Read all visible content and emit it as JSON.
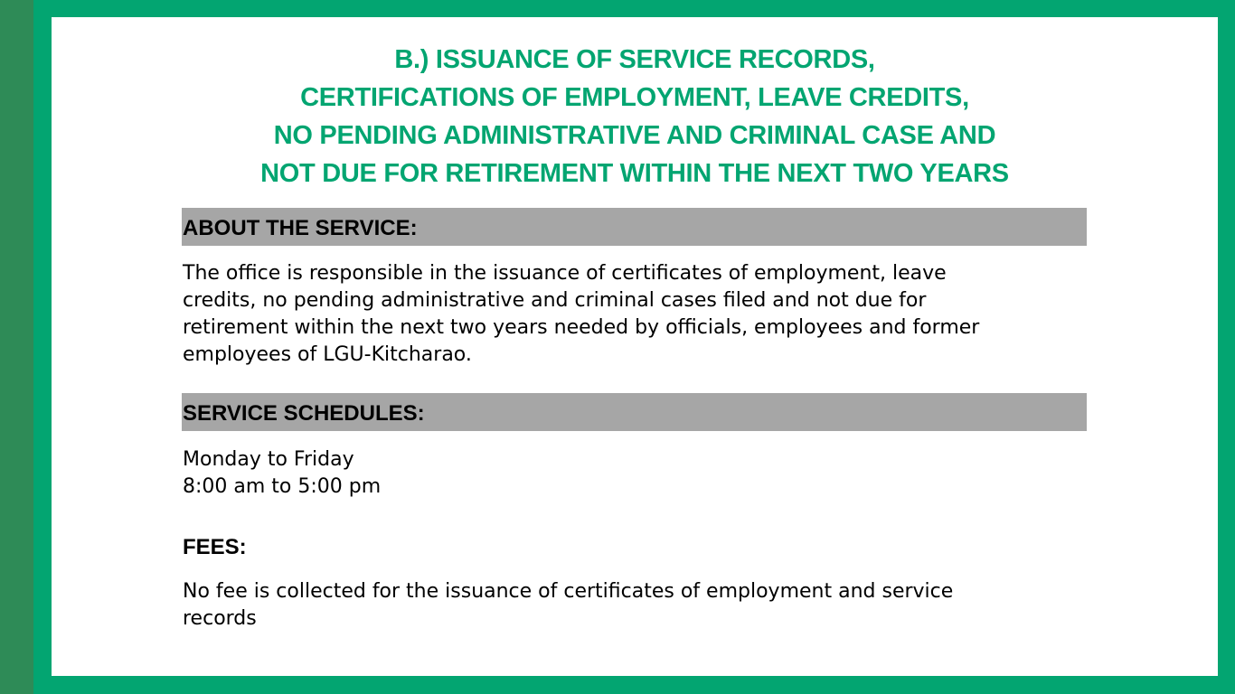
{
  "title": {
    "line1": "B.) ISSUANCE OF SERVICE RECORDS,",
    "line2": "CERTIFICATIONS OF EMPLOYMENT, LEAVE CREDITS,",
    "line3": "NO PENDING ADMINISTRATIVE AND CRIMINAL CASE AND",
    "line4": "NOT DUE FOR RETIREMENT WITHIN THE NEXT TWO YEARS"
  },
  "about": {
    "heading": "ABOUT THE SERVICE:",
    "line1": "The office is responsible in the issuance of certificates of employment, leave",
    "line2": "credits, no pending administrative and criminal cases filed and not due for",
    "line3": "retirement within the next two years needed by officials, employees and former",
    "line4": "employees of LGU-Kitcharao."
  },
  "schedules": {
    "heading": "SERVICE SCHEDULES:",
    "days": "Monday to Friday",
    "hours": "8:00 am to 5:00 pm"
  },
  "fees": {
    "heading": "FEES:",
    "line1": "No fee is collected for the issuance of certificates of employment and service",
    "line2": "records"
  },
  "colors": {
    "frame_green": "#03a571",
    "strip_green": "#2e8b57",
    "title_green": "#03a571",
    "section_bar_gray": "#a6a6a6"
  }
}
